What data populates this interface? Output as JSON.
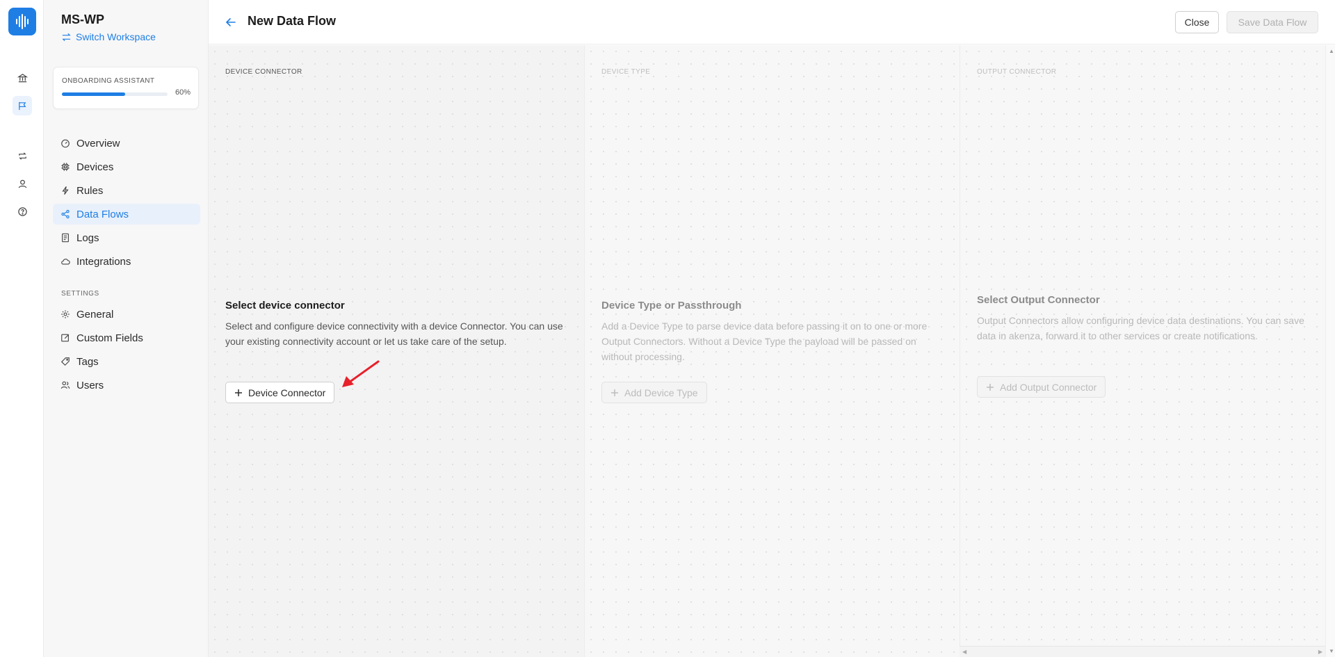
{
  "workspace": {
    "name": "MS-WP",
    "switch_label": "Switch Workspace"
  },
  "onboarding": {
    "label": "ONBOARDING ASSISTANT",
    "progress": 0.6,
    "percent_label": "60%"
  },
  "nav": {
    "items": [
      {
        "label": "Overview",
        "icon": "gauge-icon"
      },
      {
        "label": "Devices",
        "icon": "chip-icon"
      },
      {
        "label": "Rules",
        "icon": "lightning-icon"
      },
      {
        "label": "Data Flows",
        "icon": "share-nodes-icon",
        "active": true
      },
      {
        "label": "Logs",
        "icon": "log-file-icon"
      },
      {
        "label": "Integrations",
        "icon": "cloud-icon"
      }
    ],
    "settings_label": "SETTINGS",
    "settings_items": [
      {
        "label": "General",
        "icon": "gear-icon"
      },
      {
        "label": "Custom Fields",
        "icon": "edit-icon"
      },
      {
        "label": "Tags",
        "icon": "tag-icon"
      },
      {
        "label": "Users",
        "icon": "users-icon"
      }
    ]
  },
  "rail": {
    "icons": [
      "home-bank-icon",
      "flag-icon",
      "repeat-icon",
      "user-icon",
      "help-icon"
    ]
  },
  "header": {
    "title": "New Data Flow",
    "close_label": "Close",
    "save_label": "Save Data Flow"
  },
  "columns": [
    {
      "label": "DEVICE CONNECTOR",
      "title": "Select device connector",
      "description": "Select and configure device connectivity with a device Connector. You can use your existing connectivity account or let us take care of the setup.",
      "button": "Device Connector",
      "enabled": true
    },
    {
      "label": "DEVICE TYPE",
      "title": "Device Type or Passthrough",
      "description": "Add a Device Type to parse device data before passing it on to one or more Output Connectors. Without a Device Type the payload will be passed on without processing.",
      "button": "Add Device Type",
      "enabled": false
    },
    {
      "label": "OUTPUT CONNECTOR",
      "title": "Select Output Connector",
      "description": "Output Connectors allow configuring device data destinations. You can save data in akenza, forward it to other services or create notifications.",
      "button": "Add Output Connector",
      "enabled": false
    }
  ],
  "colors": {
    "accent": "#1e7ee4",
    "annotation_arrow": "#e8202a"
  }
}
